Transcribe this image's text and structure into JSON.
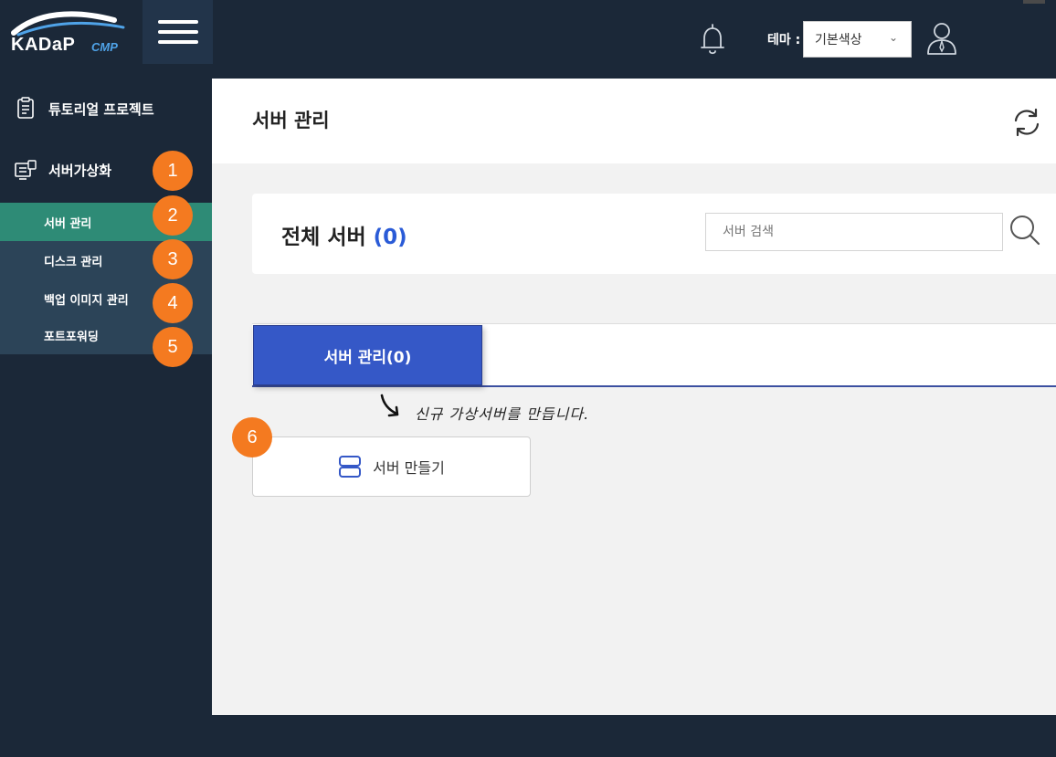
{
  "header": {
    "logo_text": "KADaP",
    "logo_sub": "CMP",
    "theme_label": "테마 :",
    "theme_value": "기본색상"
  },
  "sidebar": {
    "items": [
      {
        "label": "튜토리얼 프로젝트",
        "icon": "clipboard-icon"
      },
      {
        "label": "서버가상화",
        "icon": "server-virtualization-icon"
      }
    ],
    "submenu": [
      {
        "label": "서버 관리",
        "active": true
      },
      {
        "label": "디스크 관리",
        "active": false
      },
      {
        "label": "백업 이미지 관리",
        "active": false
      },
      {
        "label": "포트포워딩",
        "active": false
      }
    ]
  },
  "badges": [
    "1",
    "2",
    "3",
    "4",
    "5",
    "6"
  ],
  "main": {
    "page_title": "서버 관리",
    "summary_title": "전체 서버",
    "summary_count": "(0)",
    "search_placeholder": "서버 검색",
    "tab_label": "서버 관리(0)",
    "hint_text": "신규 가상서버를 만듭니다.",
    "create_button_label": "서버 만들기"
  },
  "colors": {
    "background": "#1b2838",
    "active_menu": "#2e8b76",
    "submenu_bg": "#2c4458",
    "badge": "#f47a20",
    "tab_active": "#3558c7",
    "count_accent": "#2a5bd7"
  }
}
